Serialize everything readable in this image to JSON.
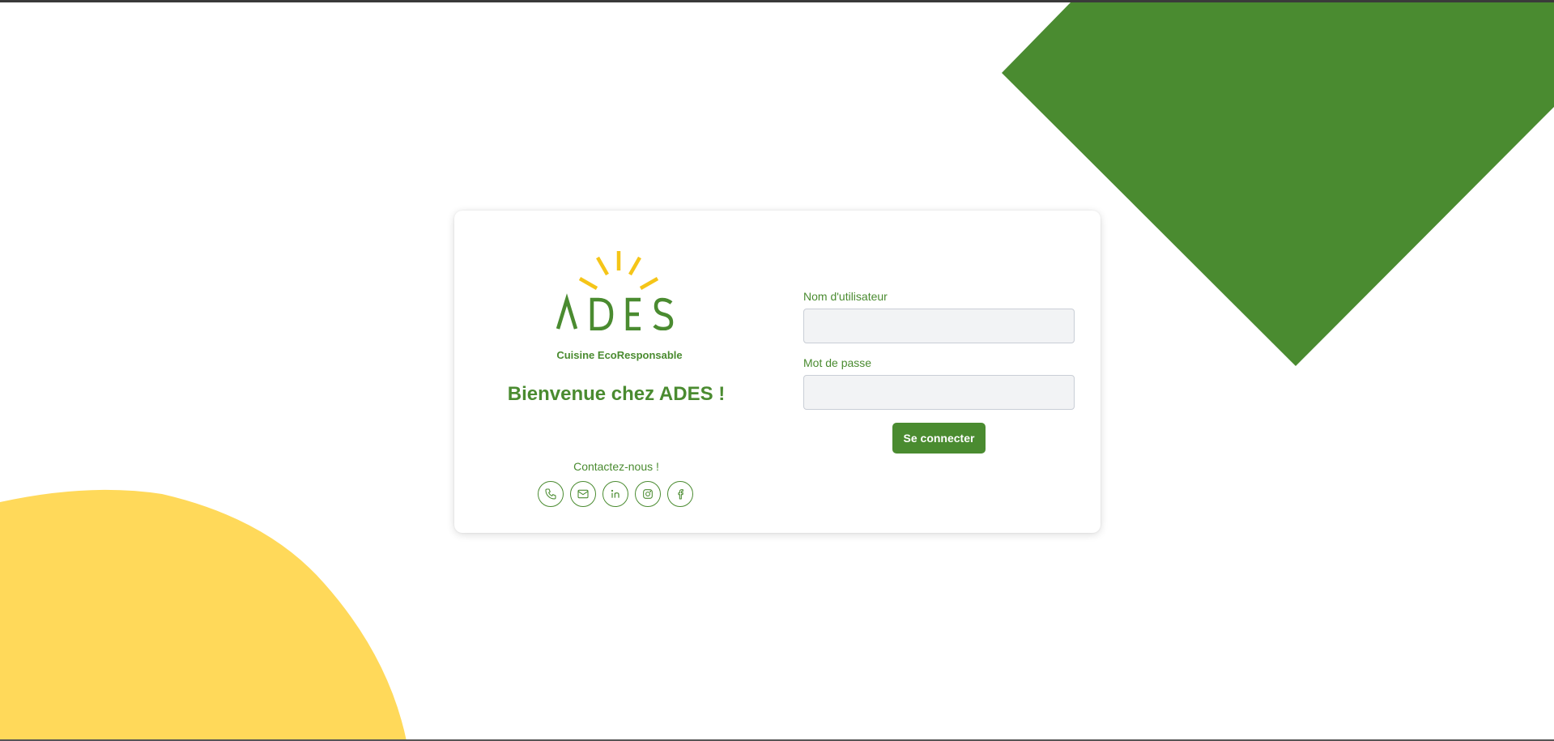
{
  "brand": {
    "logo_text": "ADES",
    "tagline": "Cuisine EcoResponsable"
  },
  "welcome": "Bienvenue chez ADES !",
  "contact": {
    "label": "Contactez-nous !",
    "icons": [
      "phone-icon",
      "mail-icon",
      "linkedin-icon",
      "instagram-icon",
      "facebook-icon"
    ]
  },
  "form": {
    "username_label": "Nom d'utilisateur",
    "username_value": "",
    "password_label": "Mot de passe",
    "password_value": "",
    "submit_label": "Se connecter"
  },
  "colors": {
    "primary_green": "#4a8b30",
    "sun_yellow": "#f5c518",
    "circle_yellow": "#ffd95a",
    "input_bg": "#f2f3f5"
  }
}
